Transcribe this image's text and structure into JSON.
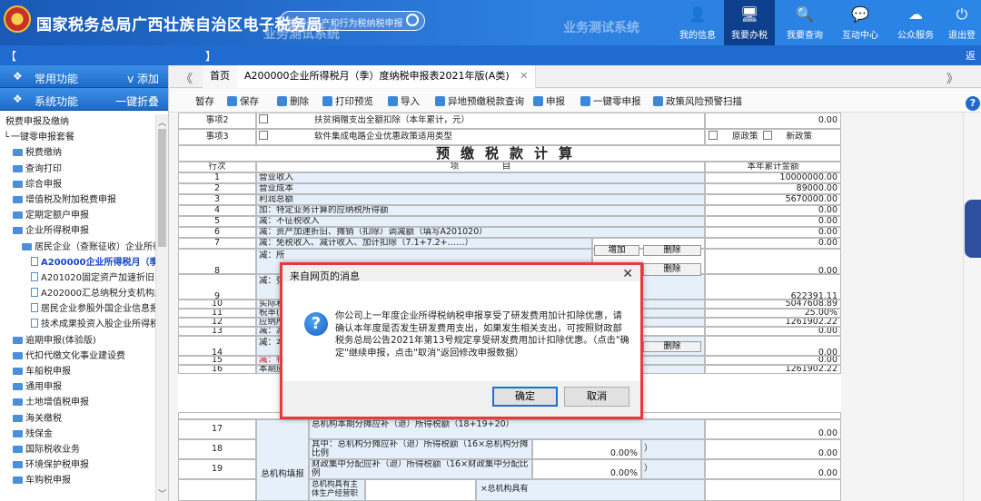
{
  "header": {
    "title": "国家税务总局广西壮族自治区电子税务局",
    "search_placeholder": "搜索: 财产和行为税纳税申报",
    "watermark_left": "业务测试系统",
    "watermark_right": "业务测试系统",
    "nav": [
      {
        "label": "我的信息",
        "icon": "user-icon"
      },
      {
        "label": "我要办税",
        "icon": "monitor-icon"
      },
      {
        "label": "我要查询",
        "icon": "search-doc-icon"
      },
      {
        "label": "互动中心",
        "icon": "chat-icon"
      },
      {
        "label": "公众服务",
        "icon": "cloud-icon"
      },
      {
        "label": "退出登",
        "icon": "power-icon"
      }
    ]
  },
  "subbar": {
    "left_bracket": "【",
    "right_bracket": "】",
    "return": "返"
  },
  "sidebar": {
    "common_label": "常用功能",
    "common_action": "添加",
    "system_label": "系统功能",
    "system_action": "一键折叠",
    "items": [
      {
        "label": "税费申报及缴纳",
        "level": 0
      },
      {
        "label": "一键零申报套餐",
        "level": 0
      },
      {
        "label": "税费缴纳",
        "level": 1
      },
      {
        "label": "查询打印",
        "level": 1
      },
      {
        "label": "综合申报",
        "level": 1
      },
      {
        "label": "增值税及附加税费申报",
        "level": 1
      },
      {
        "label": "定期定额户申报",
        "level": 1
      },
      {
        "label": "企业所得税申报",
        "level": 1
      },
      {
        "label": "居民企业（查账征收）企业所得税",
        "level": 2
      },
      {
        "label": "A200000企业所得税月（季）度",
        "level": 3,
        "active": true
      },
      {
        "label": "A201020固定资产加速折旧(扣除)",
        "level": 3
      },
      {
        "label": "A202000汇总纳税分支机构所得税",
        "level": 3
      },
      {
        "label": "居民企业参股外国企业信息报告表",
        "level": 3
      },
      {
        "label": "技术成果投资入股企业所得税递延",
        "level": 3
      },
      {
        "label": "逾期申报(体验版)",
        "level": 1
      },
      {
        "label": "代扣代缴文化事业建设费",
        "level": 1
      },
      {
        "label": "车船税申报",
        "level": 1
      },
      {
        "label": "通用申报",
        "level": 1
      },
      {
        "label": "土地增值税申报",
        "level": 1
      },
      {
        "label": "海关缴税",
        "level": 1
      },
      {
        "label": "残保金",
        "level": 1
      },
      {
        "label": "国际税收业务",
        "level": 1
      },
      {
        "label": "环境保护税申报",
        "level": 1
      },
      {
        "label": "车购税申报",
        "level": 1
      }
    ]
  },
  "tabs": {
    "nav_left": "《",
    "nav_right": "》",
    "home": "首页",
    "active": "A200000企业所得税月（季）度纳税申报表2021年版(A类)",
    "close": "✕"
  },
  "toolbar": [
    {
      "label": "暂存"
    },
    {
      "label": "保存"
    },
    {
      "label": "删除"
    },
    {
      "label": "打印预览"
    },
    {
      "label": "导入"
    },
    {
      "label": "异地预缴税款查询"
    },
    {
      "label": "申报"
    },
    {
      "label": "一键零申报"
    },
    {
      "label": "政策风险预警扫描"
    }
  ],
  "form": {
    "item2_label": "事项2",
    "item2_text": "扶贫捐赠支出全额扣除（本年累计，元）",
    "item2_value": "0.00",
    "item3_label": "事项3",
    "item3_text": "软件集成电路企业优惠政策适用类型",
    "item3_opt1": "原政策",
    "item3_opt2": "新政策",
    "section_title": "预缴税款计算",
    "col_row": "行次",
    "col_item": "项　　　　　目",
    "col_amount": "本年累计金额",
    "rows": [
      {
        "no": "1",
        "item": "营业收入",
        "value": "10000000.00"
      },
      {
        "no": "2",
        "item": "营业成本",
        "value": "89000.00"
      },
      {
        "no": "3",
        "item": "利润总额",
        "value": "5670000.00"
      },
      {
        "no": "4",
        "item": "加：特定业务计算的应纳税所得额",
        "value": "0.00"
      },
      {
        "no": "5",
        "item": "减：不征税收入",
        "value": "0.00"
      },
      {
        "no": "6",
        "item": "减：资产加速折旧、摊销（扣除）调减额（填写A201020）",
        "value": "0.00"
      },
      {
        "no": "7",
        "item": "减：免税收入、减计收入、加计扣除（7.1+7.2+……）",
        "value": "0.00"
      },
      {
        "no": "8",
        "item": "减：所",
        "value": "0.00"
      },
      {
        "no": "9",
        "item": "减：弥",
        "value": "622391.11"
      },
      {
        "no": "10",
        "item": "实际利",
        "value": "5047608.89"
      },
      {
        "no": "11",
        "item": "税率(",
        "value": "25.00%"
      },
      {
        "no": "12",
        "item": "应纳所",
        "value": "1261902.22"
      },
      {
        "no": "13",
        "item": "减：减",
        "value": "0.00"
      },
      {
        "no": "14",
        "item": "减：本",
        "value": "0.00"
      },
      {
        "no": "15",
        "item": "减：特",
        "value": "0.00"
      },
      {
        "no": "16",
        "item": "本期应",
        "value": "1261902.22"
      }
    ],
    "add_btn": "增加",
    "del_btn": "删除",
    "lower": {
      "group_label": "总机构填报",
      "r17_no": "17",
      "r17_text": "总机构本期分摊应补（退）所得税额（18+19+20）",
      "r17_value": "0.00",
      "r18_no": "18",
      "r18_text": "其中：总机构分摊应补（退）所得税额（16×总机构分摊比例",
      "r18_pct": "0.00%",
      "r18_tail": "）",
      "r18_value": "0.00",
      "r19_no": "19",
      "r19_text": "财政集中分配应补（退）所得税额（16×财政集中分配比例",
      "r19_pct": "0.00%",
      "r19_tail": "）",
      "r19_value": "0.00",
      "r20_text": "总机构具有主体生产经营职",
      "r20_tail": "×总机构具有"
    }
  },
  "dialog": {
    "title": "来自网页的消息",
    "close": "✕",
    "message": "你公司上一年度企业所得税纳税申报享受了研发费用加计扣除优惠，请确认本年度是否发生研发费用支出，如果发生相关支出，可按照财政部税务总局公告2021年第13号规定享受研发费用加计扣除优惠。（点击\"确定\"继续申报，点击\"取消\"返回修改申报数据）",
    "ok": "确定",
    "cancel": "取消"
  },
  "colors": {
    "header_blue": "#1a59b6",
    "dialog_border": "#e63b3b",
    "cell_blue": "#e5f0fb"
  }
}
